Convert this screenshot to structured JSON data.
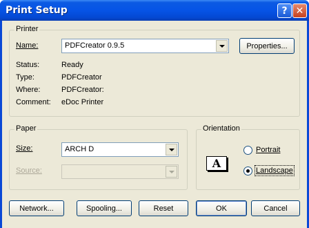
{
  "window": {
    "title": "Print Setup",
    "help_label": "?",
    "close_label": "✕"
  },
  "printer": {
    "legend": "Printer",
    "name_label": "Name:",
    "name_value": "PDFCreator 0.9.5",
    "properties_label": "Properties...",
    "status_label": "Status:",
    "status_value": "Ready",
    "type_label": "Type:",
    "type_value": "PDFCreator",
    "where_label": "Where:",
    "where_value": "PDFCreator:",
    "comment_label": "Comment:",
    "comment_value": "eDoc Printer"
  },
  "paper": {
    "legend": "Paper",
    "size_label": "Size:",
    "size_value": "ARCH D",
    "source_label": "Source:",
    "source_value": ""
  },
  "orientation": {
    "legend": "Orientation",
    "icon_letter": "A",
    "portrait_label": "Portrait",
    "landscape_label": "Landscape",
    "selected": "Landscape"
  },
  "buttons": {
    "network": "Network...",
    "spooling": "Spooling...",
    "reset": "Reset",
    "ok": "OK",
    "cancel": "Cancel"
  }
}
